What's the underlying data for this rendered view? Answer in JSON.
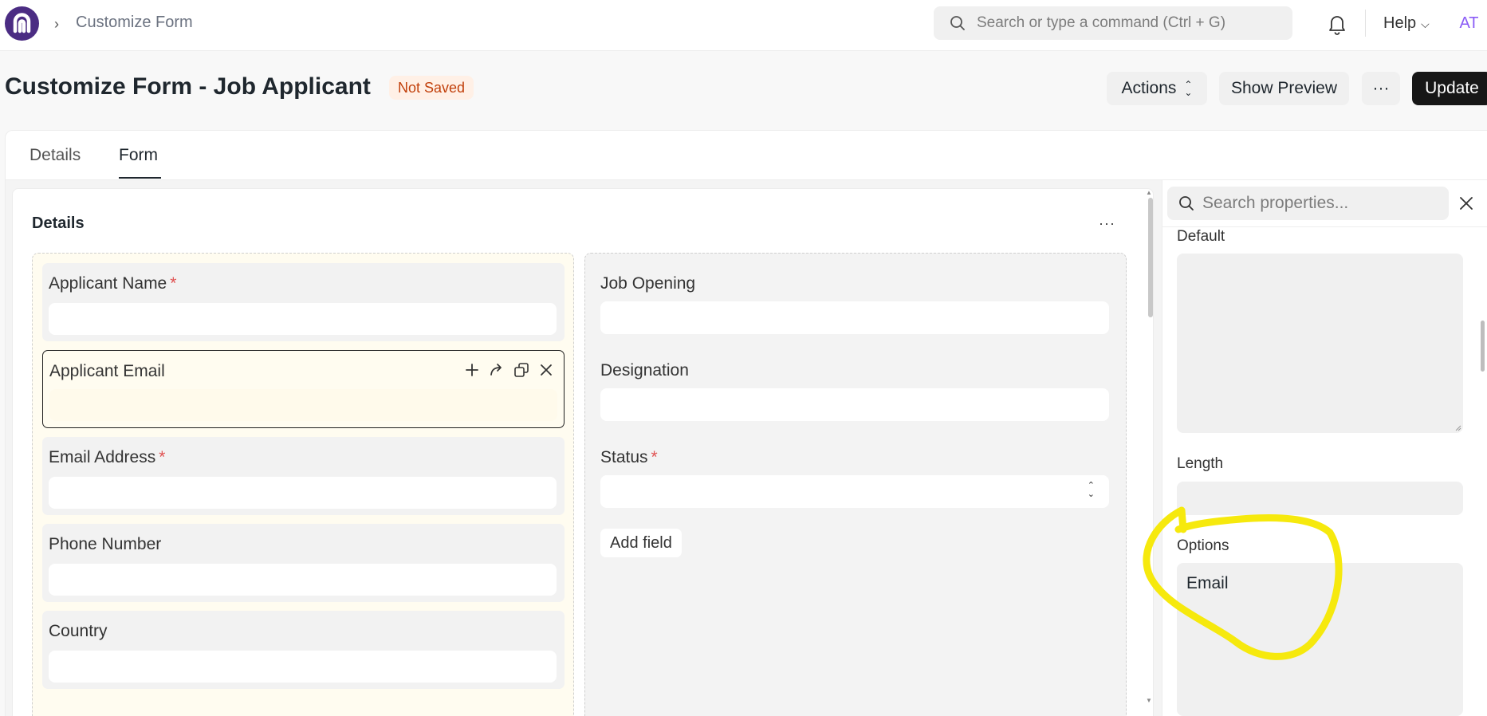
{
  "navbar": {
    "breadcrumb": "Customize Form",
    "search_placeholder": "Search or type a command (Ctrl + G)",
    "help_label": "Help",
    "avatar_initials": "AT"
  },
  "header": {
    "title": "Customize Form - Job Applicant",
    "status_badge": "Not Saved",
    "actions_label": "Actions",
    "preview_label": "Show Preview",
    "more_label": "···",
    "update_label": "Update"
  },
  "tabs": [
    {
      "label": "Details",
      "active": false
    },
    {
      "label": "Form",
      "active": true
    }
  ],
  "section": {
    "title": "Details",
    "more_label": "···"
  },
  "left_fields": [
    {
      "label": "Applicant Name",
      "required": true
    },
    {
      "label": "Applicant Email",
      "required": false,
      "selected": true
    },
    {
      "label": "Email Address",
      "required": true
    },
    {
      "label": "Phone Number",
      "required": false
    },
    {
      "label": "Country",
      "required": false
    }
  ],
  "right_fields": [
    {
      "label": "Job Opening",
      "required": false
    },
    {
      "label": "Designation",
      "required": false
    },
    {
      "label": "Status",
      "required": true,
      "type": "select"
    }
  ],
  "add_field_label": "Add field",
  "required_mark": "*",
  "sidebar": {
    "search_placeholder": "Search properties...",
    "default_label": "Default",
    "length_label": "Length",
    "options_label": "Options",
    "options_value": "Email"
  },
  "colors": {
    "brand": "#4b2c83",
    "required": "#e05252",
    "badge_bg": "#fff0e6",
    "badge_text": "#c2410c",
    "annotation": "#f5e800"
  }
}
